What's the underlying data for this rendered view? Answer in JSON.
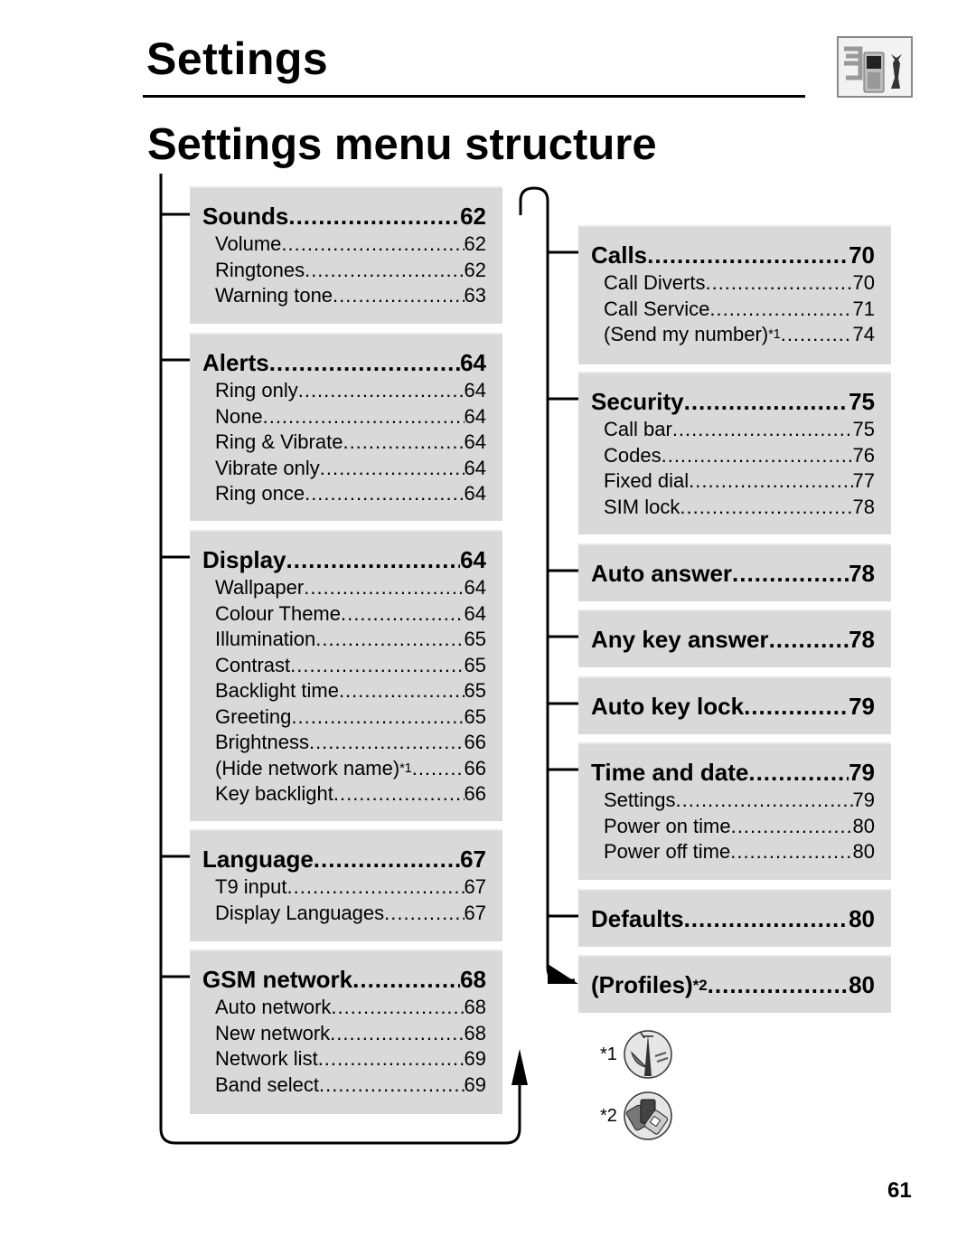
{
  "header": {
    "title": "Settings",
    "icon": "settings-phone-tools-icon"
  },
  "page_title": "Settings menu structure",
  "left_column": [
    {
      "label": "Sounds",
      "page": "62",
      "items": [
        {
          "label": "Volume",
          "page": "62"
        },
        {
          "label": "Ringtones",
          "page": "62"
        },
        {
          "label": "Warning tone",
          "page": "63"
        }
      ]
    },
    {
      "label": "Alerts",
      "page": "64",
      "items": [
        {
          "label": "Ring only",
          "page": "64"
        },
        {
          "label": "None",
          "page": "64"
        },
        {
          "label": "Ring & Vibrate",
          "page": "64"
        },
        {
          "label": "Vibrate only",
          "page": "64"
        },
        {
          "label": "Ring once",
          "page": "64"
        }
      ]
    },
    {
      "label": "Display",
      "page": "64",
      "items": [
        {
          "label": "Wallpaper",
          "page": "64"
        },
        {
          "label": "Colour Theme",
          "page": "64"
        },
        {
          "label": "Illumination",
          "page": "65"
        },
        {
          "label": "Contrast",
          "page": "65"
        },
        {
          "label": "Backlight time",
          "page": "65"
        },
        {
          "label": "Greeting",
          "page": "65"
        },
        {
          "label": "Brightness",
          "page": "66"
        },
        {
          "label": "(Hide network name)",
          "sup": "*1",
          "page": "66"
        },
        {
          "label": "Key backlight",
          "page": "66"
        }
      ]
    },
    {
      "label": "Language",
      "page": "67",
      "items": [
        {
          "label": "T9 input",
          "page": "67"
        },
        {
          "label": "Display Languages",
          "page": "67"
        }
      ]
    },
    {
      "label": "GSM network",
      "page": "68",
      "items": [
        {
          "label": "Auto network",
          "page": "68"
        },
        {
          "label": "New network",
          "page": "68"
        },
        {
          "label": "Network list",
          "page": "69"
        },
        {
          "label": "Band select",
          "page": "69"
        }
      ]
    }
  ],
  "right_column": [
    {
      "label": "Calls",
      "page": "70",
      "items": [
        {
          "label": "Call Diverts",
          "page": "70"
        },
        {
          "label": "Call Service",
          "page": "71"
        },
        {
          "label": "(Send my number)",
          "sup": "*1",
          "page": "74"
        }
      ]
    },
    {
      "label": "Security",
      "page": "75",
      "items": [
        {
          "label": "Call bar",
          "page": "75"
        },
        {
          "label": "Codes",
          "page": "76"
        },
        {
          "label": "Fixed dial",
          "page": "77"
        },
        {
          "label": "SIM lock",
          "page": "78"
        }
      ]
    },
    {
      "label": "Auto answer",
      "page": "78",
      "items": []
    },
    {
      "label": "Any key answer",
      "page": "78",
      "items": []
    },
    {
      "label": "Auto key lock",
      "page": "79",
      "items": []
    },
    {
      "label": "Time and date",
      "page": "79",
      "items": [
        {
          "label": "Settings",
          "page": "79"
        },
        {
          "label": "Power on time",
          "page": "80"
        },
        {
          "label": "Power off time",
          "page": "80"
        }
      ]
    },
    {
      "label": "Defaults",
      "page": "80",
      "items": []
    },
    {
      "label": "(Profiles)",
      "sup": "*2",
      "page": "80",
      "items": []
    }
  ],
  "footnotes": [
    {
      "mark": "*1",
      "icon": "network-operator-icon"
    },
    {
      "mark": "*2",
      "icon": "sim-card-icon"
    }
  ],
  "page_number": "61",
  "colors": {
    "box_bg": "#d9d9d9",
    "text": "#000000"
  }
}
